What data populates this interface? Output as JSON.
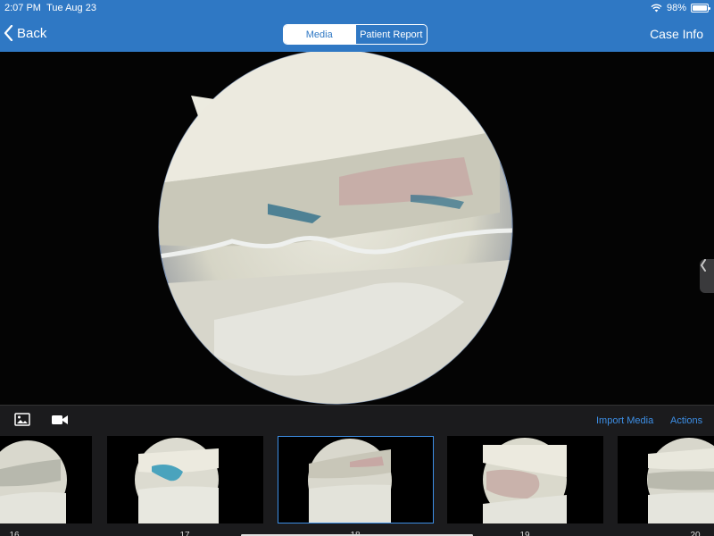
{
  "status": {
    "time": "2:07 PM",
    "date": "Tue Aug 23",
    "battery": "98%",
    "battery_level": 0.98
  },
  "nav": {
    "back_label": "Back",
    "segments": [
      {
        "label": "Media",
        "active": true
      },
      {
        "label": "Patient Report",
        "active": false
      }
    ],
    "case_info_label": "Case Info"
  },
  "viewer": {
    "icons": [
      "chevron-left-icon"
    ]
  },
  "media_panel": {
    "tools": [
      "photo-icon",
      "video-camera-icon"
    ],
    "import_label": "Import Media",
    "actions_label": "Actions",
    "thumbnails": [
      {
        "label": "16",
        "selected": false
      },
      {
        "label": "17",
        "selected": false
      },
      {
        "label": "18",
        "selected": true
      },
      {
        "label": "19",
        "selected": false
      },
      {
        "label": "20",
        "selected": false
      }
    ]
  },
  "colors": {
    "nav_bar": "#2f78c4",
    "accent": "#3d8fe6",
    "panel": "#1b1b1d"
  }
}
